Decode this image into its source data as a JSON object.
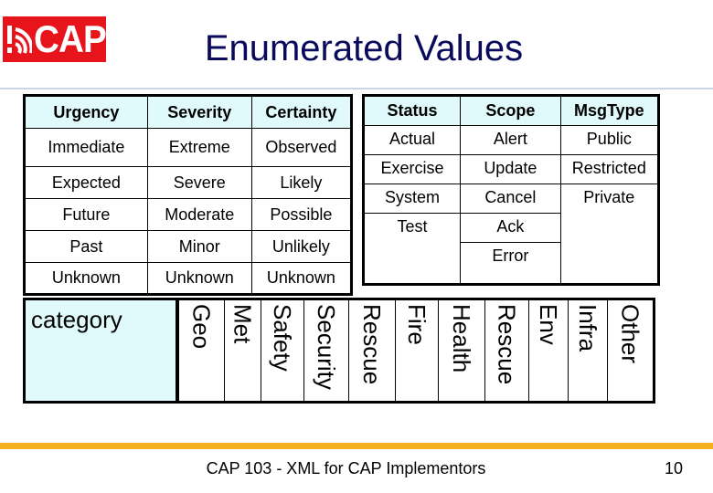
{
  "logo": {
    "text": "CAP",
    "icon": "alert-broadcast-icon",
    "color": "#e8141b"
  },
  "title": "Enumerated Values",
  "table1": {
    "headers": [
      "Urgency",
      "Severity",
      "Certainty"
    ],
    "rows": [
      [
        "Immediate",
        "Extreme",
        "Observed"
      ],
      [
        "Expected",
        "Severe",
        "Likely"
      ],
      [
        "Future",
        "Moderate",
        "Possible"
      ],
      [
        "Past",
        "Minor",
        "Unlikely"
      ],
      [
        "Unknown",
        "Unknown",
        "Unknown"
      ]
    ]
  },
  "table2": {
    "headers": [
      "Status",
      "Scope",
      "MsgType"
    ],
    "status": [
      "Actual",
      "Exercise",
      "System",
      "Test"
    ],
    "scope": [
      "Alert",
      "Update",
      "Cancel",
      "Ack",
      "Error"
    ],
    "msgtype": [
      "Public",
      "Restricted",
      "Private"
    ]
  },
  "category": {
    "label": "category",
    "values": [
      "Geo",
      "Met",
      "Safety",
      "Security",
      "Rescue",
      "Fire",
      "Health",
      "Rescue",
      "Env",
      "Infra",
      "Other"
    ]
  },
  "footer": {
    "text": "CAP 103 - XML for CAP Implementors",
    "page": "10"
  },
  "colors": {
    "header_bg": "#e0fafc",
    "title": "#0a0a5c",
    "footer_rule": "#f5b01d"
  }
}
